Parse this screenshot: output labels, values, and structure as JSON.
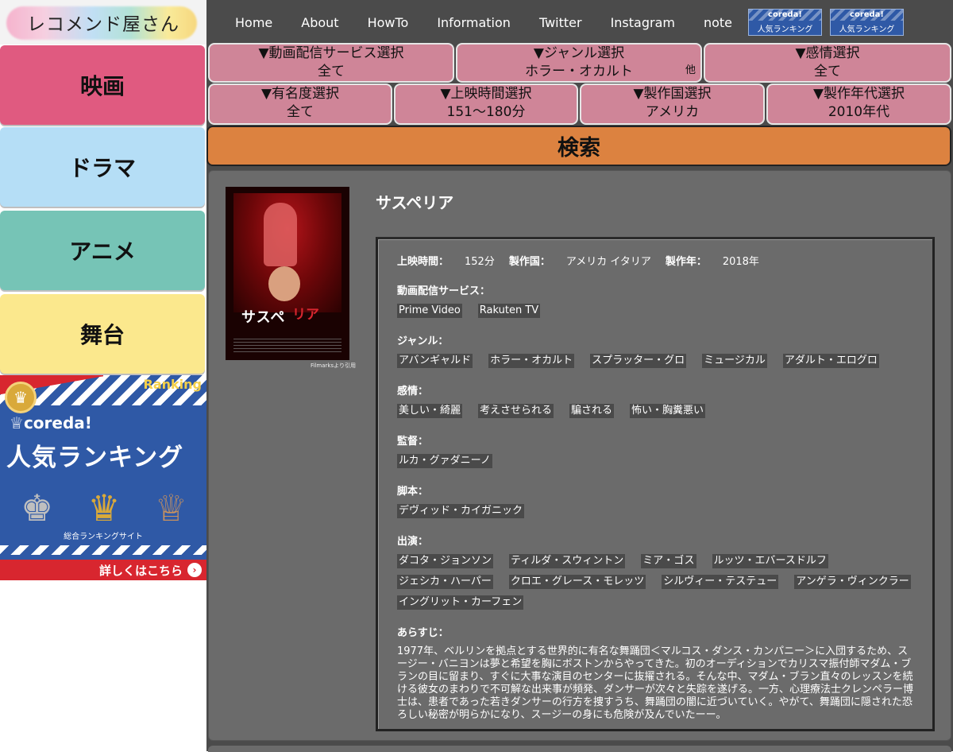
{
  "logo": {
    "text": "レコメンド屋さん"
  },
  "categories": [
    {
      "label": "映画",
      "color": "#e05a80"
    },
    {
      "label": "ドラマ",
      "color": "#b5def6"
    },
    {
      "label": "アニメ",
      "color": "#76c4b6"
    },
    {
      "label": "舞台",
      "color": "#fbe88d"
    }
  ],
  "ranking_banner": {
    "tag": "Ranking",
    "brand": "coreda!",
    "headline": "人気ランキング",
    "sub": "総合ランキングサイト",
    "cta": "詳しくはこちら"
  },
  "nav": {
    "items": [
      "Home",
      "About",
      "HowTo",
      "Information",
      "Twitter",
      "Instagram",
      "note"
    ],
    "mini_banners": [
      {
        "brand": "coreda!",
        "label": "人気ランキング"
      },
      {
        "brand": "coreda!",
        "label": "人気ランキング"
      }
    ]
  },
  "filters": {
    "row1": [
      {
        "label": "▼動画配信サービス選択",
        "value": "全て",
        "other": ""
      },
      {
        "label": "▼ジャンル選択",
        "value": "ホラー・オカルト",
        "other": "他"
      },
      {
        "label": "▼感情選択",
        "value": "全て",
        "other": ""
      }
    ],
    "row2": [
      {
        "label": "▼有名度選択",
        "value": "全て"
      },
      {
        "label": "▼上映時間選択",
        "value": "151〜180分"
      },
      {
        "label": "▼製作国選択",
        "value": "アメリカ"
      },
      {
        "label": "▼製作年代選択",
        "value": "2010年代"
      }
    ]
  },
  "search_button": "検索",
  "movie": {
    "title": "サスペリア",
    "poster_title": "サスペ",
    "poster_title_red": "リア",
    "poster_credit": "Filmarksより引用",
    "meta": {
      "runtime_label": "上映時間：",
      "runtime": "152分",
      "country_label": "製作国：",
      "country": "アメリカ イタリア",
      "year_label": "製作年：",
      "year": "2018年"
    },
    "streaming_label": "動画配信サービス：",
    "streaming": [
      "Prime Video",
      "Rakuten TV"
    ],
    "genre_label": "ジャンル：",
    "genres": [
      "アバンギャルド",
      "ホラー・オカルト",
      "スプラッター・グロ",
      "ミュージカル",
      "アダルト・エログロ"
    ],
    "emotion_label": "感情：",
    "emotions": [
      "美しい・綺麗",
      "考えさせられる",
      "騙される",
      "怖い・胸糞悪い"
    ],
    "director_label": "監督：",
    "directors": [
      "ルカ・グァダニーノ"
    ],
    "writer_label": "脚本：",
    "writers": [
      "デヴィッド・カイガニック"
    ],
    "cast_label": "出演：",
    "cast": [
      "ダコタ・ジョンソン",
      "ティルダ・スウィントン",
      "ミア・ゴス",
      "ルッツ・エバースドルフ",
      "ジェシカ・ハーパー",
      "クロエ・グレース・モレッツ",
      "シルヴィー・テステュー",
      "アンゲラ・ヴィンクラー",
      "イングリット・カーフェン"
    ],
    "synopsis_label": "あらすじ：",
    "synopsis": "1977年、ベルリンを拠点とする世界的に有名な舞踊団＜マルコス・ダンス・カンパニー＞に入団するため、スージー・バニヨンは夢と希望を胸にボストンからやってきた。初のオーディションでカリスマ振付師マダム・ブランの目に留まり、すぐに大事な演目のセンターに抜擢される。そんな中、マダム・ブラン直々のレッスンを続ける彼女のまわりで不可解な出来事が頻発、ダンサーが次々と失踪を遂げる。一方、心理療法士クレンペラー博士は、患者であった若きダンサーの行方を捜すうち、舞踊団の闇に近づいていく。やがて、舞踊団に隠された恐ろしい秘密が明らかになり、スージーの身にも危険が及んでいたーー。"
  }
}
